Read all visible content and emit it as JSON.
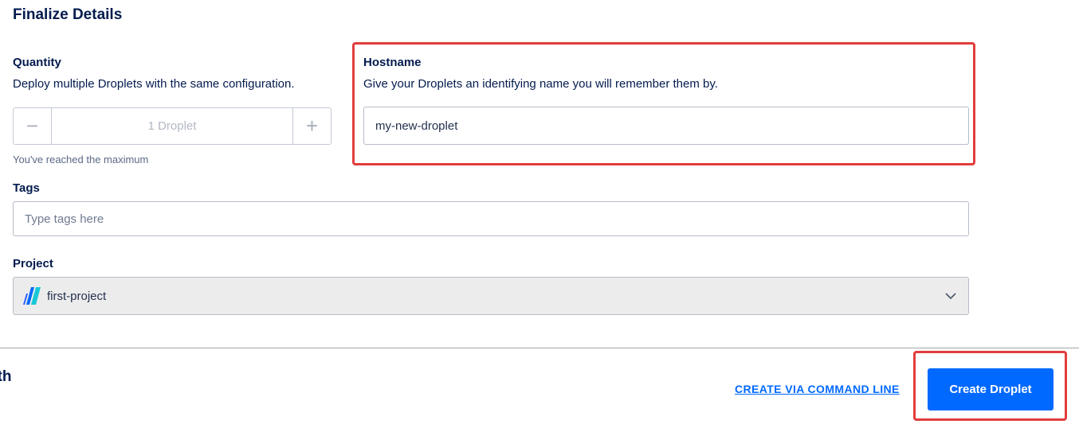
{
  "section": {
    "title": "Finalize Details"
  },
  "quantity": {
    "label": "Quantity",
    "description": "Deploy multiple Droplets with the same configuration.",
    "value": "1 Droplet",
    "decrement_symbol": "−",
    "increment_symbol": "+",
    "helper": "You've reached the maximum"
  },
  "hostname": {
    "label": "Hostname",
    "description": "Give your Droplets an identifying name you will remember them by.",
    "value": "my-new-droplet"
  },
  "tags": {
    "label": "Tags",
    "placeholder": "Type tags here"
  },
  "project": {
    "label": "Project",
    "selected": "first-project",
    "icon": "project-icon"
  },
  "footer": {
    "partial_heading": "ath",
    "cli_link": "CREATE VIA COMMAND LINE",
    "create_button": "Create Droplet"
  },
  "colors": {
    "primary": "#0069ff",
    "highlight": "#e23c3c",
    "heading": "#031b4e"
  }
}
